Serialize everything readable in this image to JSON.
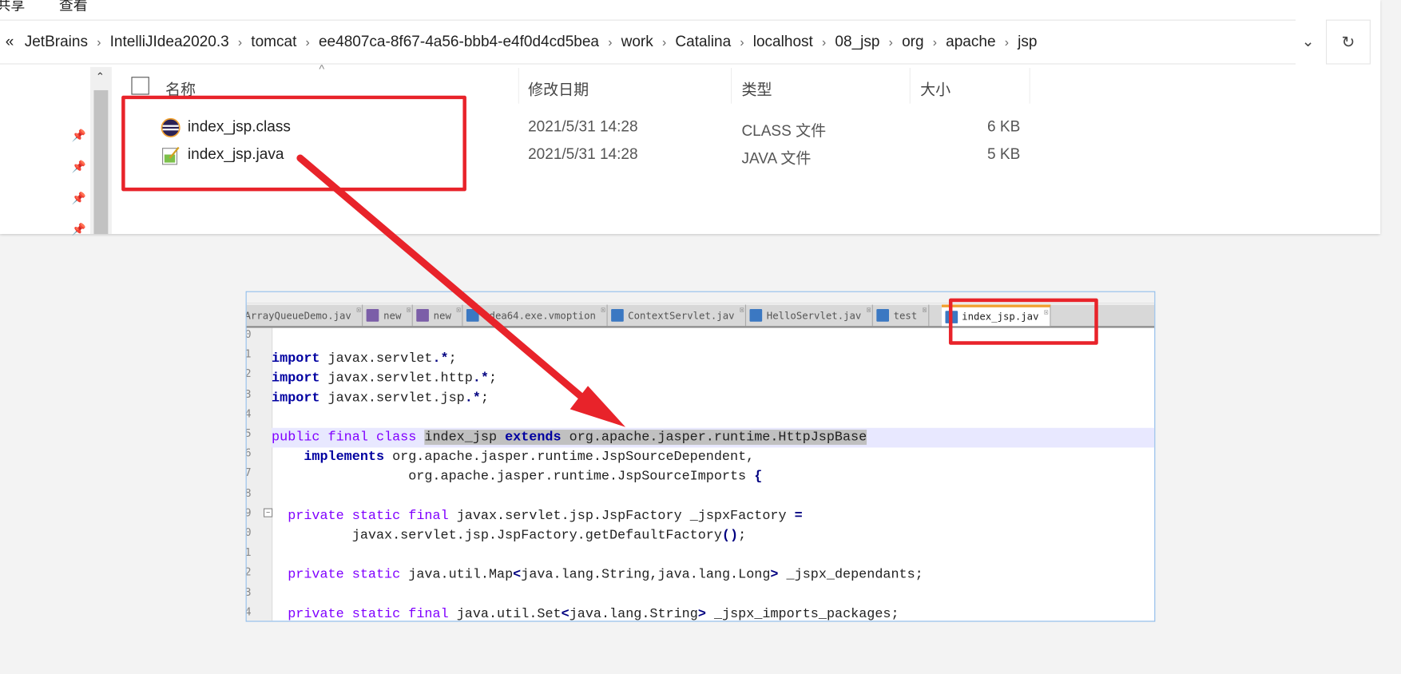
{
  "menu": {
    "share": "共享",
    "view": "查看"
  },
  "address": {
    "overflow": "«",
    "crumbs": [
      "JetBrains",
      "IntelliJIdea2020.3",
      "tomcat",
      "ee4807ca-8f67-4a56-bbb4-e4f0d4cd5bea",
      "work",
      "Catalina",
      "localhost",
      "08_jsp",
      "org",
      "apache",
      "jsp"
    ],
    "dropdown_icon": "chevron-down",
    "refresh_icon": "↻"
  },
  "columns": {
    "name": "名称",
    "modified": "修改日期",
    "type": "类型",
    "size": "大小"
  },
  "files": [
    {
      "name": "index_jsp.class",
      "modified": "2021/5/31 14:28",
      "type": "CLASS 文件",
      "size": "6 KB",
      "icon": "eclipse-class-icon"
    },
    {
      "name": "index_jsp.java",
      "modified": "2021/5/31 14:28",
      "type": "JAVA 文件",
      "size": "5 KB",
      "icon": "java-file-icon"
    }
  ],
  "editor": {
    "tabs": [
      "ArrayQueueDemo.jav",
      "new",
      "new",
      "idea64.exe.vmoption",
      "ContextServlet.jav",
      "HelloServlet.jav",
      "test",
      "index_jsp.jav"
    ],
    "active_tab": "index_jsp.jav",
    "line_numbers": [
      "0",
      "1",
      "2",
      "3",
      "4",
      "5",
      "6",
      "7",
      "8",
      "9",
      "0",
      "1",
      "2",
      "3",
      "4"
    ],
    "code": [
      "import javax.servlet.*;",
      "import javax.servlet.http.*;",
      "import javax.servlet.jsp.*;",
      "public final class index_jsp extends org.apache.jasper.runtime.HttpJspBase",
      "    implements org.apache.jasper.runtime.JspSourceDependent,",
      "                 org.apache.jasper.runtime.JspSourceImports {",
      "  private static final javax.servlet.jsp.JspFactory _jspxFactory =",
      "          javax.servlet.jsp.JspFactory.getDefaultFactory();",
      "  private static java.util.Map<java.lang.String,java.lang.Long> _jspx_dependants;",
      "  private static final java.util.Set<java.lang.String> _jspx_imports_packages;"
    ]
  },
  "colors": {
    "annotation_red": "#e8232a",
    "keyword": "#8000ff",
    "bold_keyword": "#0000a0",
    "selection": "#c0c0c0"
  }
}
